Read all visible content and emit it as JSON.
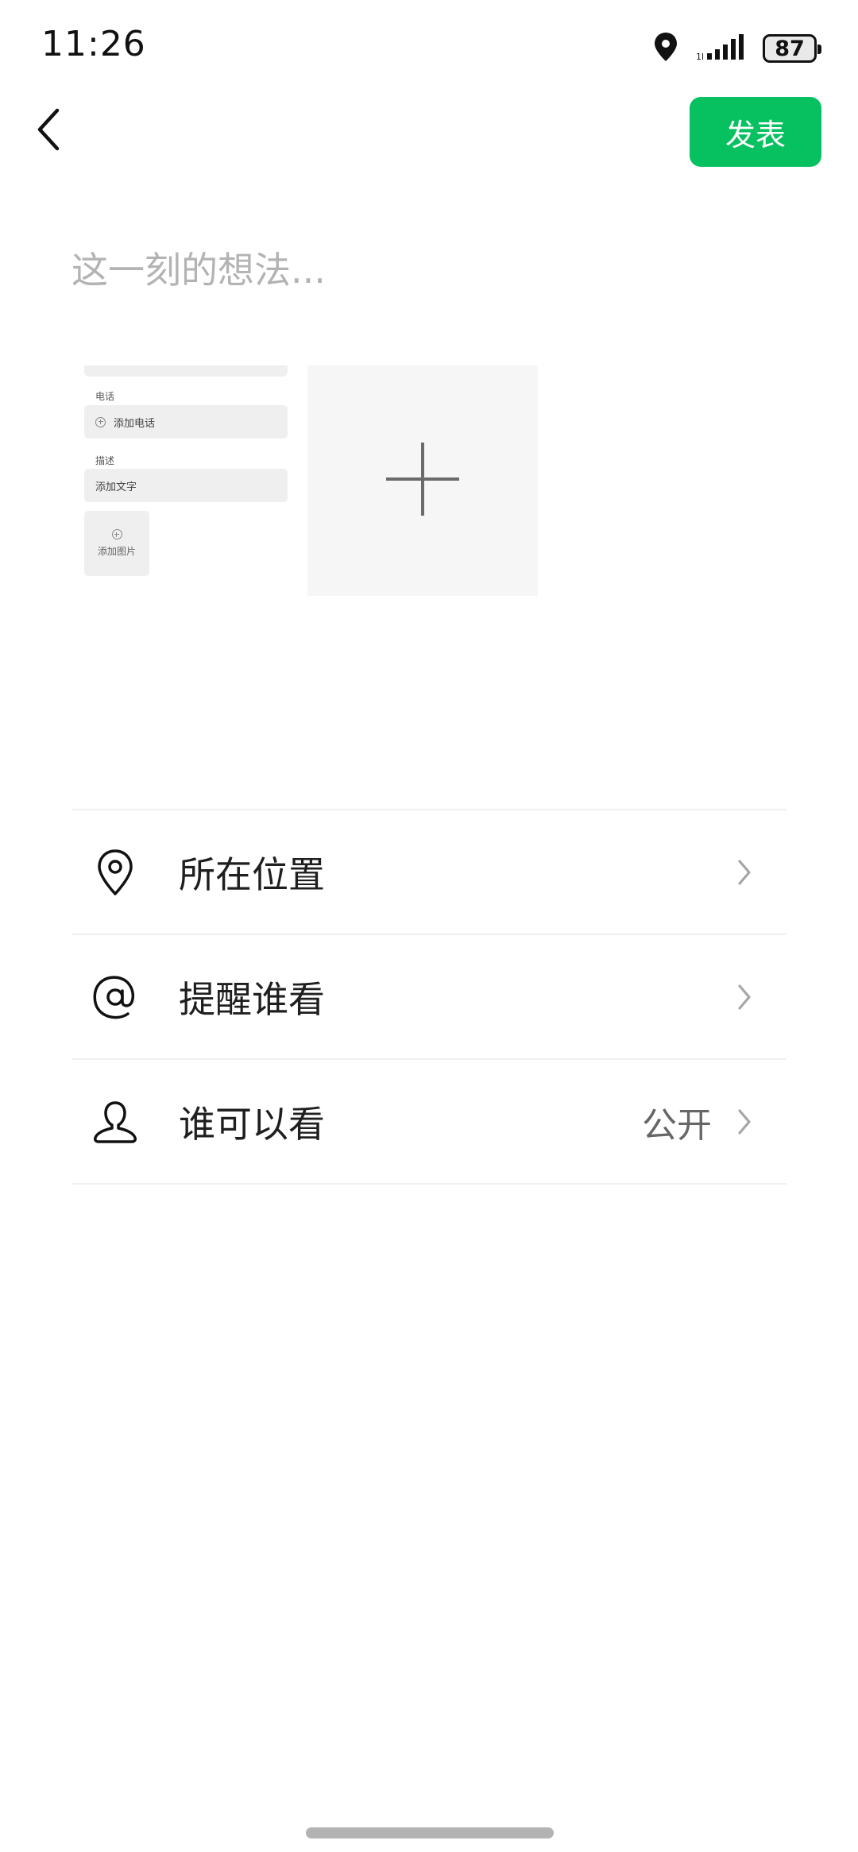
{
  "status_bar": {
    "time": "11:26",
    "battery": "87",
    "icons": [
      "location-icon",
      "signal-icon",
      "battery-icon"
    ]
  },
  "top_bar": {
    "back_icon": "chevron-left-icon",
    "publish_label": "发表",
    "accent_color": "#07c160"
  },
  "composer": {
    "placeholder": "这一刻的想法..."
  },
  "thumbnail": {
    "phone_label": "电话",
    "add_phone": "添加电话",
    "desc_label": "描述",
    "add_text": "添加文字",
    "add_image": "添加图片"
  },
  "add_tile": {
    "icon": "plus-icon"
  },
  "options": [
    {
      "icon": "location-pin-icon",
      "label": "所在位置",
      "value": ""
    },
    {
      "icon": "at-sign-icon",
      "label": "提醒谁看",
      "value": ""
    },
    {
      "icon": "person-icon",
      "label": "谁可以看",
      "value": "公开"
    }
  ]
}
